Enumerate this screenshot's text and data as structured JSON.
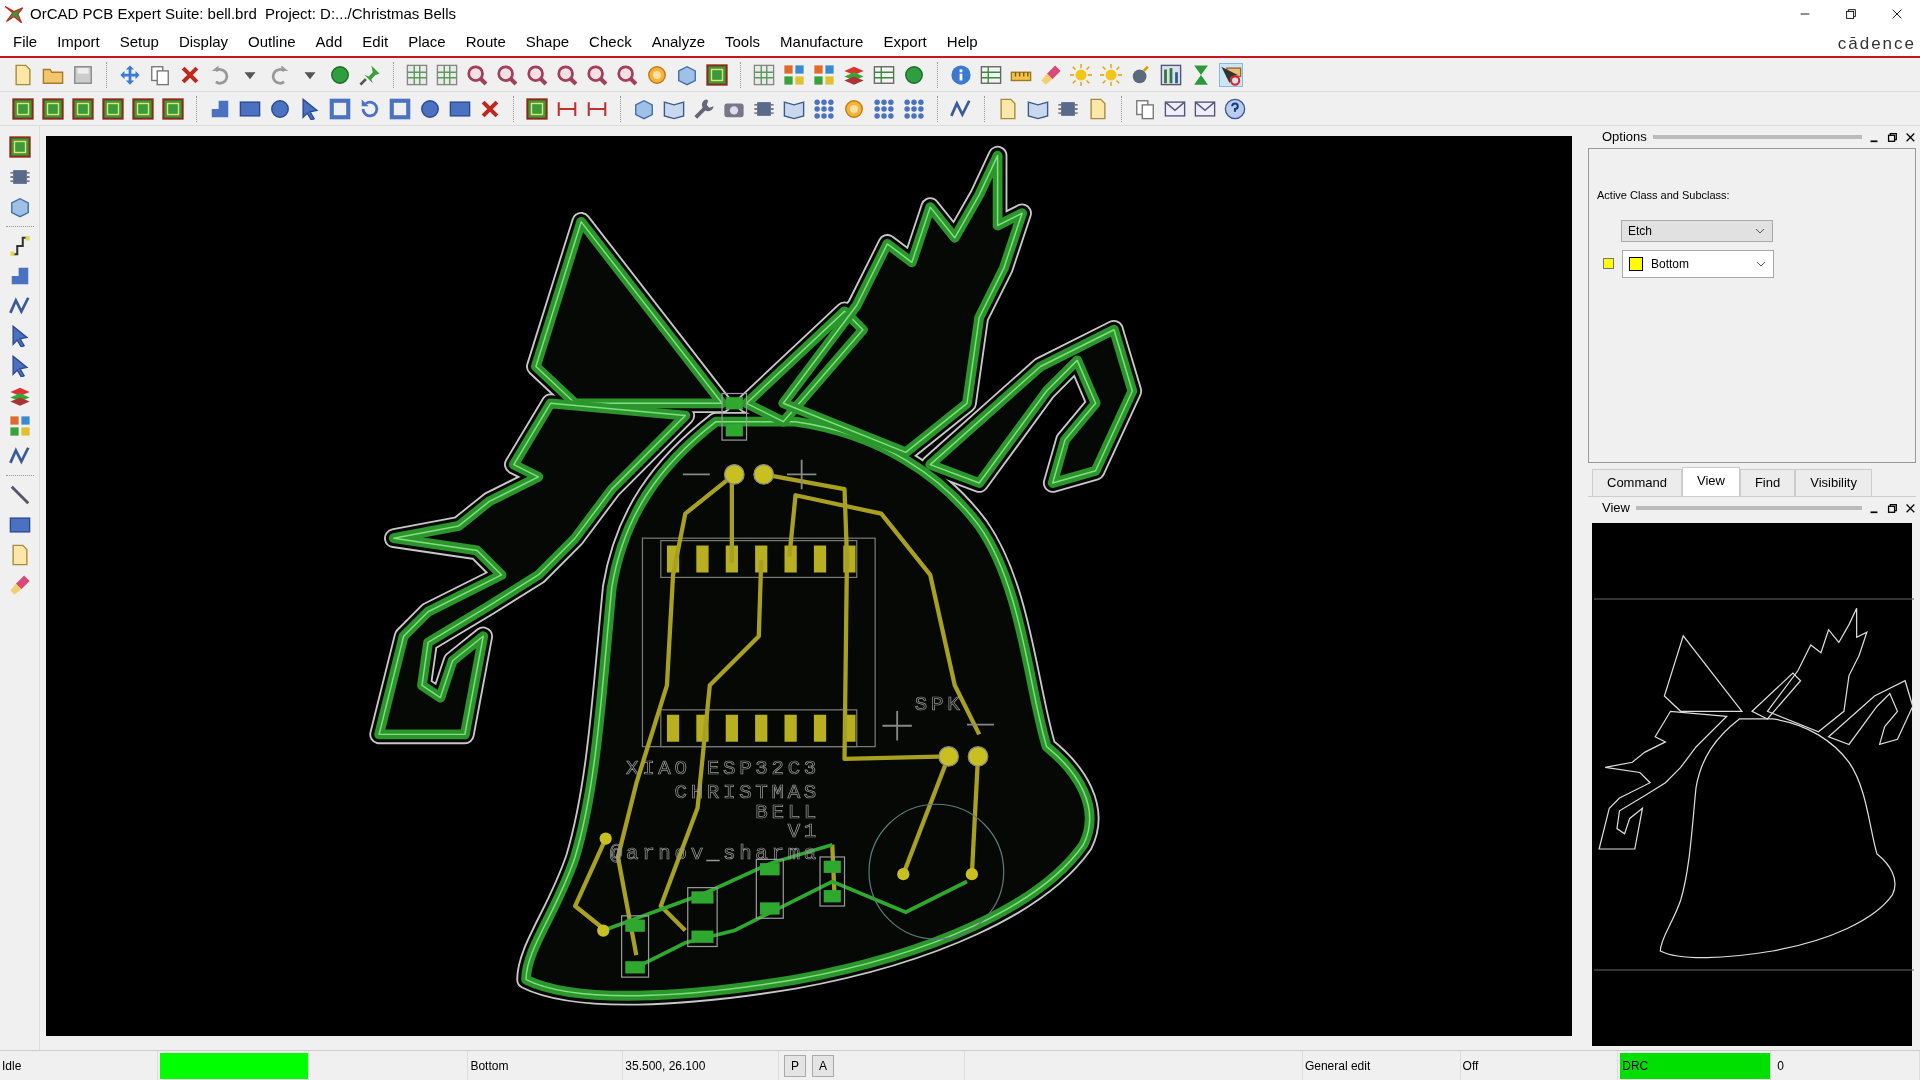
{
  "window": {
    "title": "OrCAD PCB Expert Suite: bell.brd  Project: D:.../Christmas Bells",
    "brand": "cādence"
  },
  "menu": [
    {
      "label": "File"
    },
    {
      "label": "Import"
    },
    {
      "label": "Setup"
    },
    {
      "label": "Display"
    },
    {
      "label": "Outline"
    },
    {
      "label": "Add"
    },
    {
      "label": "Edit"
    },
    {
      "label": "Place"
    },
    {
      "label": "Route"
    },
    {
      "label": "Shape"
    },
    {
      "label": "Check"
    },
    {
      "label": "Analyze"
    },
    {
      "label": "Tools"
    },
    {
      "label": "Manufacture"
    },
    {
      "label": "Export"
    },
    {
      "label": "Help"
    }
  ],
  "canvas": {
    "silkscreen": [
      "XIAO ESP32C3",
      "CHRISTMAS",
      "BELL",
      "V1",
      "@arnov_sharma",
      "SPK"
    ]
  },
  "options_panel": {
    "title": "Options",
    "label": "Active Class and Subclass:",
    "class_value": "Etch",
    "subclass": {
      "value": "Bottom",
      "color": "#ffff00"
    }
  },
  "tabs": [
    {
      "label": "Command",
      "selected": false
    },
    {
      "label": "View",
      "selected": true
    },
    {
      "label": "Find",
      "selected": false
    },
    {
      "label": "Visibility",
      "selected": false
    }
  ],
  "view_panel": {
    "title": "View"
  },
  "status_bar": {
    "state": "Idle",
    "layer": "Bottom",
    "coordinates": "35.500, 26.100",
    "buttons": [
      "P",
      "A"
    ],
    "mode": "General edit",
    "drc_mode": "Off",
    "drc_label": "DRC",
    "drc_count": "0"
  }
}
